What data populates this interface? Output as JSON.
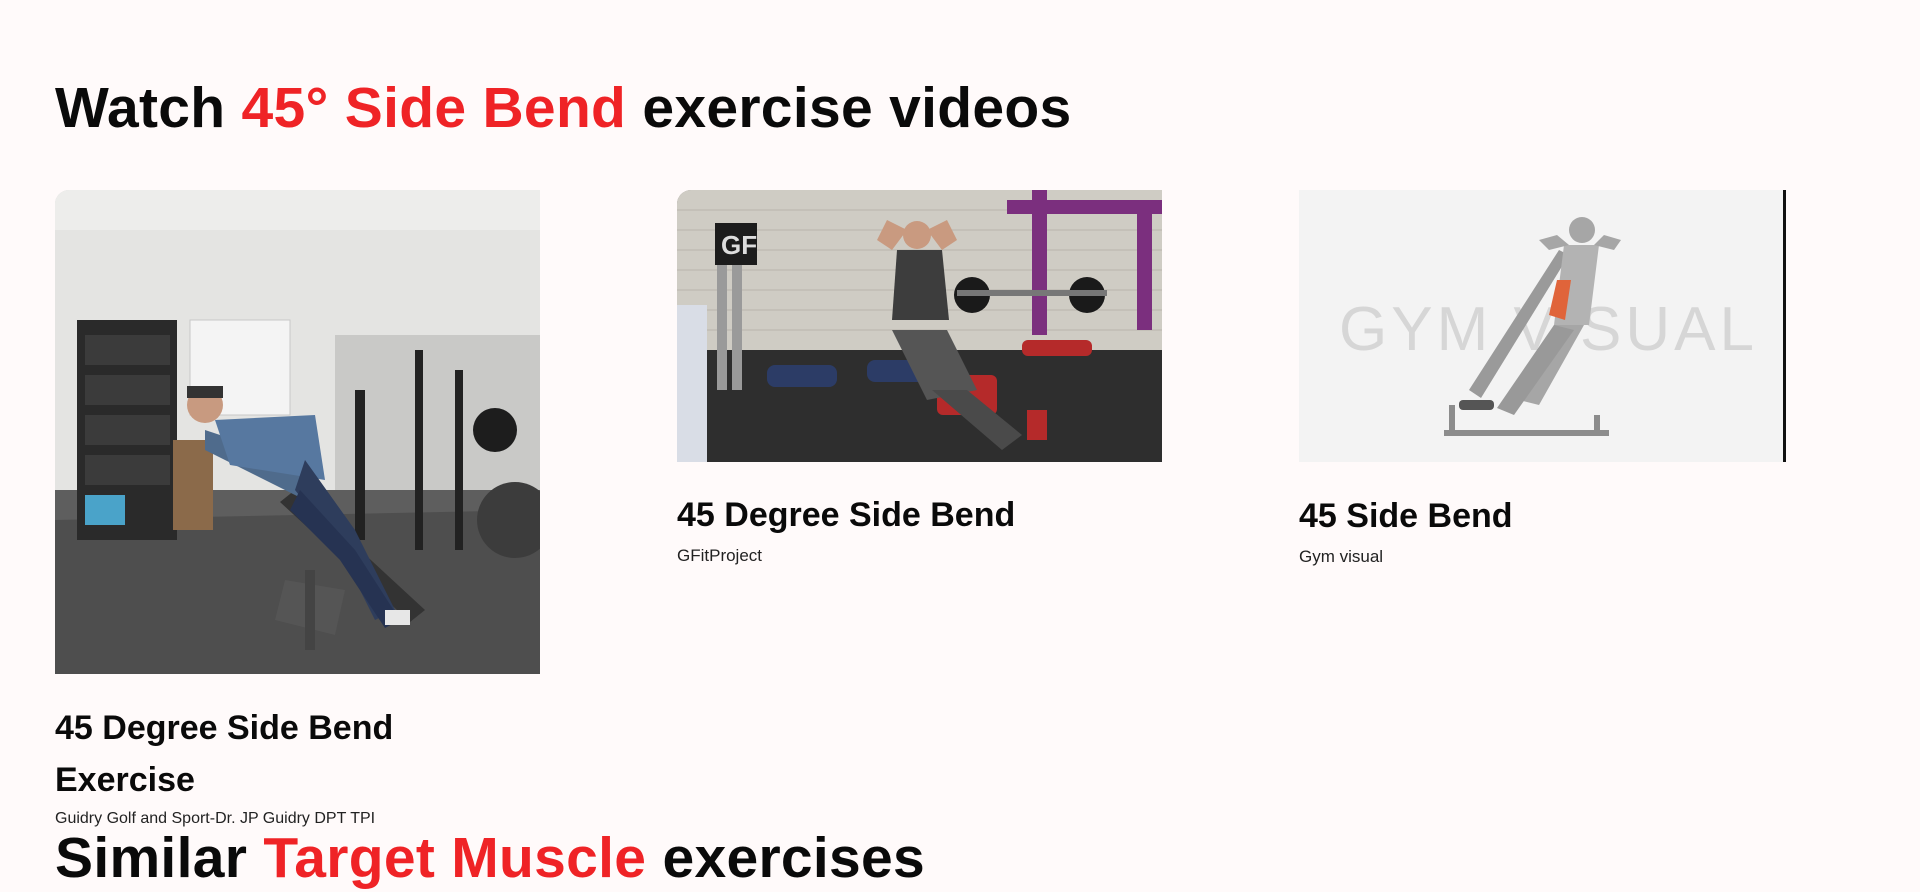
{
  "watch_section": {
    "prefix": "Watch",
    "highlight": "45° Side Bend",
    "suffix": "exercise videos"
  },
  "videos": [
    {
      "title": "45 Degree Side Bend Exercise",
      "channel": "Guidry Golf and Sport-Dr. JP Guidry DPT TPI"
    },
    {
      "title": "45 Degree Side Bend",
      "channel": "GFitProject",
      "logo_text": "GF"
    },
    {
      "title": "45 Side Bend",
      "channel": "Gym visual",
      "watermark": "GYM VISUAL"
    }
  ],
  "similar_section": {
    "prefix": "Similar",
    "highlight": "Target Muscle",
    "suffix": "exercises"
  },
  "colors": {
    "accent": "#ef2326",
    "background": "#fffafa",
    "text": "#0a0a0a"
  }
}
